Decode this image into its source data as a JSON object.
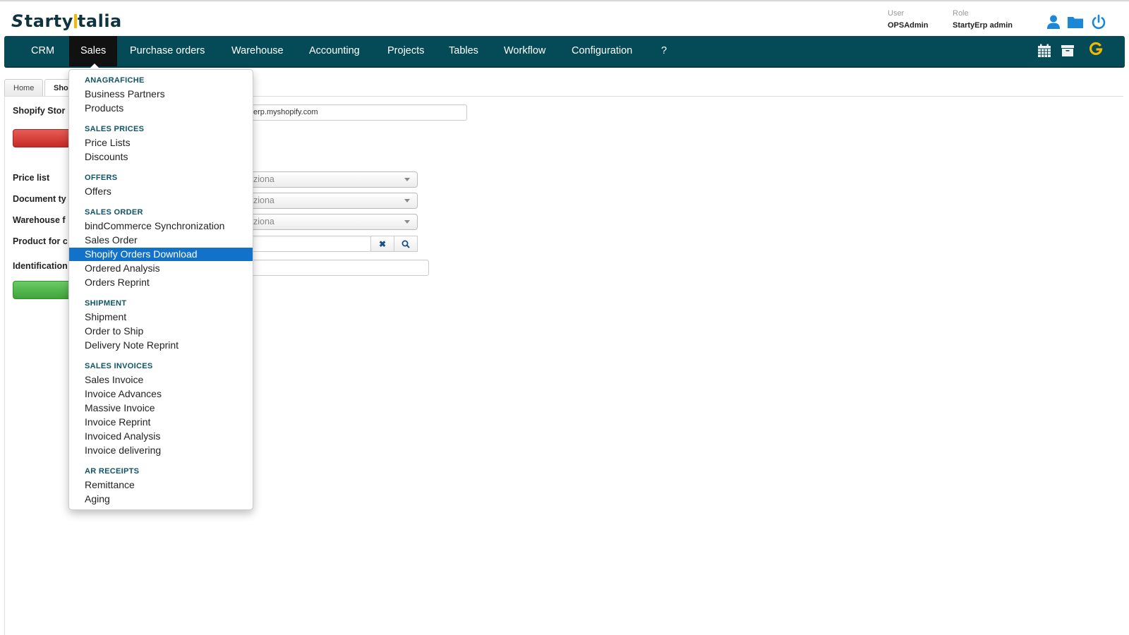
{
  "header": {
    "logo_prefix": "S",
    "logo_part1": "tarty",
    "logo_part2": "talia",
    "user_label": "User",
    "user_value": "OPSAdmin",
    "role_label": "Role",
    "role_value": "StartyErp admin",
    "icons": [
      "user-icon",
      "folder-icon",
      "power-icon"
    ]
  },
  "nav": {
    "items": [
      {
        "label": "CRM"
      },
      {
        "label": "Sales",
        "active": true
      },
      {
        "label": "Purchase orders"
      },
      {
        "label": "Warehouse"
      },
      {
        "label": "Accounting"
      },
      {
        "label": "Projects"
      },
      {
        "label": "Tables"
      },
      {
        "label": "Workflow"
      },
      {
        "label": "Configuration"
      },
      {
        "label": "?"
      }
    ],
    "right_icons": [
      "calendar-icon",
      "archive-icon",
      "google-icon"
    ],
    "google_letter": "G"
  },
  "tabs": [
    {
      "label": "Home"
    },
    {
      "label": "Sho",
      "active": true
    }
  ],
  "form": {
    "shopify_store_label": "Shopify Stor",
    "shopify_store_value": "erp.myshopify.com",
    "price_list_label": "Price list",
    "document_type_label": "Document ty",
    "warehouse_label": "Warehouse f",
    "product_label": "Product for c",
    "identification_label": "Identification",
    "select_placeholder": "ziona",
    "clear_symbol": "✖",
    "search_symbol": "🔍"
  },
  "dropdown": {
    "sections": [
      {
        "heading": "ANAGRAFICHE",
        "items": [
          "Business Partners",
          "Products"
        ]
      },
      {
        "heading": "SALES PRICES",
        "items": [
          "Price Lists",
          "Discounts"
        ]
      },
      {
        "heading": "OFFERS",
        "items": [
          "Offers"
        ]
      },
      {
        "heading": "SALES ORDER",
        "items": [
          "bindCommerce Synchronization",
          "Sales Order",
          "Shopify Orders Download",
          "Ordered Analysis",
          "Orders Reprint"
        ]
      },
      {
        "heading": "SHIPMENT",
        "items": [
          "Shipment",
          "Order to Ship",
          "Delivery Note Reprint"
        ]
      },
      {
        "heading": "SALES INVOICES",
        "items": [
          "Sales Invoice",
          "Invoice Advances",
          "Massive Invoice",
          "Invoice Reprint",
          "Invoiced Analysis",
          "Invoice delivering"
        ]
      },
      {
        "heading": "AR RECEIPTS",
        "items": [
          "Remittance",
          "Aging"
        ]
      }
    ],
    "selected_item": "Shopify Orders Download"
  },
  "colors": {
    "nav_bg": "#054b57",
    "accent_blue": "#1272c9",
    "logo_yellow": "#f5b800",
    "section_heading": "#0f5366"
  }
}
